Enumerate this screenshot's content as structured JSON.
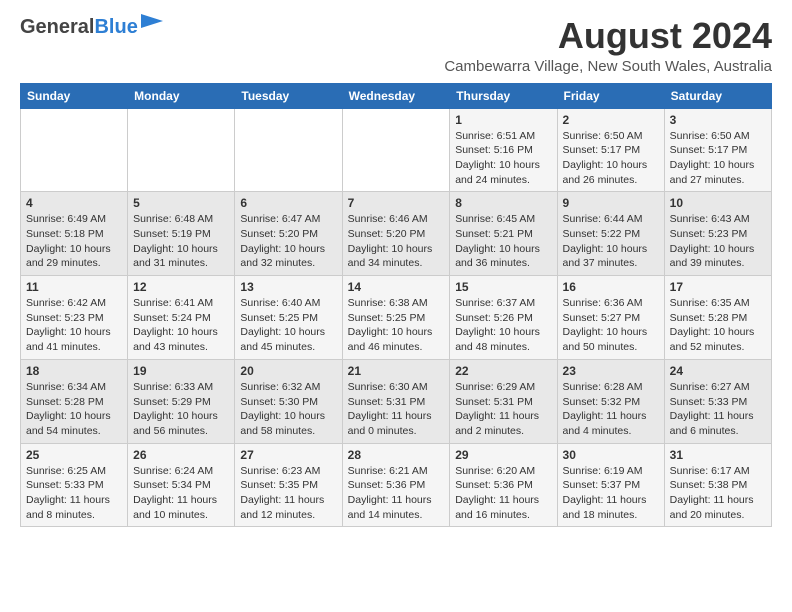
{
  "header": {
    "logo_general": "General",
    "logo_blue": "Blue",
    "title": "August 2024",
    "subtitle": "Cambewarra Village, New South Wales, Australia"
  },
  "calendar": {
    "days_of_week": [
      "Sunday",
      "Monday",
      "Tuesday",
      "Wednesday",
      "Thursday",
      "Friday",
      "Saturday"
    ],
    "weeks": [
      [
        {
          "day": "",
          "info": ""
        },
        {
          "day": "",
          "info": ""
        },
        {
          "day": "",
          "info": ""
        },
        {
          "day": "",
          "info": ""
        },
        {
          "day": "1",
          "info": "Sunrise: 6:51 AM\nSunset: 5:16 PM\nDaylight: 10 hours\nand 24 minutes."
        },
        {
          "day": "2",
          "info": "Sunrise: 6:50 AM\nSunset: 5:17 PM\nDaylight: 10 hours\nand 26 minutes."
        },
        {
          "day": "3",
          "info": "Sunrise: 6:50 AM\nSunset: 5:17 PM\nDaylight: 10 hours\nand 27 minutes."
        }
      ],
      [
        {
          "day": "4",
          "info": "Sunrise: 6:49 AM\nSunset: 5:18 PM\nDaylight: 10 hours\nand 29 minutes."
        },
        {
          "day": "5",
          "info": "Sunrise: 6:48 AM\nSunset: 5:19 PM\nDaylight: 10 hours\nand 31 minutes."
        },
        {
          "day": "6",
          "info": "Sunrise: 6:47 AM\nSunset: 5:20 PM\nDaylight: 10 hours\nand 32 minutes."
        },
        {
          "day": "7",
          "info": "Sunrise: 6:46 AM\nSunset: 5:20 PM\nDaylight: 10 hours\nand 34 minutes."
        },
        {
          "day": "8",
          "info": "Sunrise: 6:45 AM\nSunset: 5:21 PM\nDaylight: 10 hours\nand 36 minutes."
        },
        {
          "day": "9",
          "info": "Sunrise: 6:44 AM\nSunset: 5:22 PM\nDaylight: 10 hours\nand 37 minutes."
        },
        {
          "day": "10",
          "info": "Sunrise: 6:43 AM\nSunset: 5:23 PM\nDaylight: 10 hours\nand 39 minutes."
        }
      ],
      [
        {
          "day": "11",
          "info": "Sunrise: 6:42 AM\nSunset: 5:23 PM\nDaylight: 10 hours\nand 41 minutes."
        },
        {
          "day": "12",
          "info": "Sunrise: 6:41 AM\nSunset: 5:24 PM\nDaylight: 10 hours\nand 43 minutes."
        },
        {
          "day": "13",
          "info": "Sunrise: 6:40 AM\nSunset: 5:25 PM\nDaylight: 10 hours\nand 45 minutes."
        },
        {
          "day": "14",
          "info": "Sunrise: 6:38 AM\nSunset: 5:25 PM\nDaylight: 10 hours\nand 46 minutes."
        },
        {
          "day": "15",
          "info": "Sunrise: 6:37 AM\nSunset: 5:26 PM\nDaylight: 10 hours\nand 48 minutes."
        },
        {
          "day": "16",
          "info": "Sunrise: 6:36 AM\nSunset: 5:27 PM\nDaylight: 10 hours\nand 50 minutes."
        },
        {
          "day": "17",
          "info": "Sunrise: 6:35 AM\nSunset: 5:28 PM\nDaylight: 10 hours\nand 52 minutes."
        }
      ],
      [
        {
          "day": "18",
          "info": "Sunrise: 6:34 AM\nSunset: 5:28 PM\nDaylight: 10 hours\nand 54 minutes."
        },
        {
          "day": "19",
          "info": "Sunrise: 6:33 AM\nSunset: 5:29 PM\nDaylight: 10 hours\nand 56 minutes."
        },
        {
          "day": "20",
          "info": "Sunrise: 6:32 AM\nSunset: 5:30 PM\nDaylight: 10 hours\nand 58 minutes."
        },
        {
          "day": "21",
          "info": "Sunrise: 6:30 AM\nSunset: 5:31 PM\nDaylight: 11 hours\nand 0 minutes."
        },
        {
          "day": "22",
          "info": "Sunrise: 6:29 AM\nSunset: 5:31 PM\nDaylight: 11 hours\nand 2 minutes."
        },
        {
          "day": "23",
          "info": "Sunrise: 6:28 AM\nSunset: 5:32 PM\nDaylight: 11 hours\nand 4 minutes."
        },
        {
          "day": "24",
          "info": "Sunrise: 6:27 AM\nSunset: 5:33 PM\nDaylight: 11 hours\nand 6 minutes."
        }
      ],
      [
        {
          "day": "25",
          "info": "Sunrise: 6:25 AM\nSunset: 5:33 PM\nDaylight: 11 hours\nand 8 minutes."
        },
        {
          "day": "26",
          "info": "Sunrise: 6:24 AM\nSunset: 5:34 PM\nDaylight: 11 hours\nand 10 minutes."
        },
        {
          "day": "27",
          "info": "Sunrise: 6:23 AM\nSunset: 5:35 PM\nDaylight: 11 hours\nand 12 minutes."
        },
        {
          "day": "28",
          "info": "Sunrise: 6:21 AM\nSunset: 5:36 PM\nDaylight: 11 hours\nand 14 minutes."
        },
        {
          "day": "29",
          "info": "Sunrise: 6:20 AM\nSunset: 5:36 PM\nDaylight: 11 hours\nand 16 minutes."
        },
        {
          "day": "30",
          "info": "Sunrise: 6:19 AM\nSunset: 5:37 PM\nDaylight: 11 hours\nand 18 minutes."
        },
        {
          "day": "31",
          "info": "Sunrise: 6:17 AM\nSunset: 5:38 PM\nDaylight: 11 hours\nand 20 minutes."
        }
      ]
    ]
  }
}
